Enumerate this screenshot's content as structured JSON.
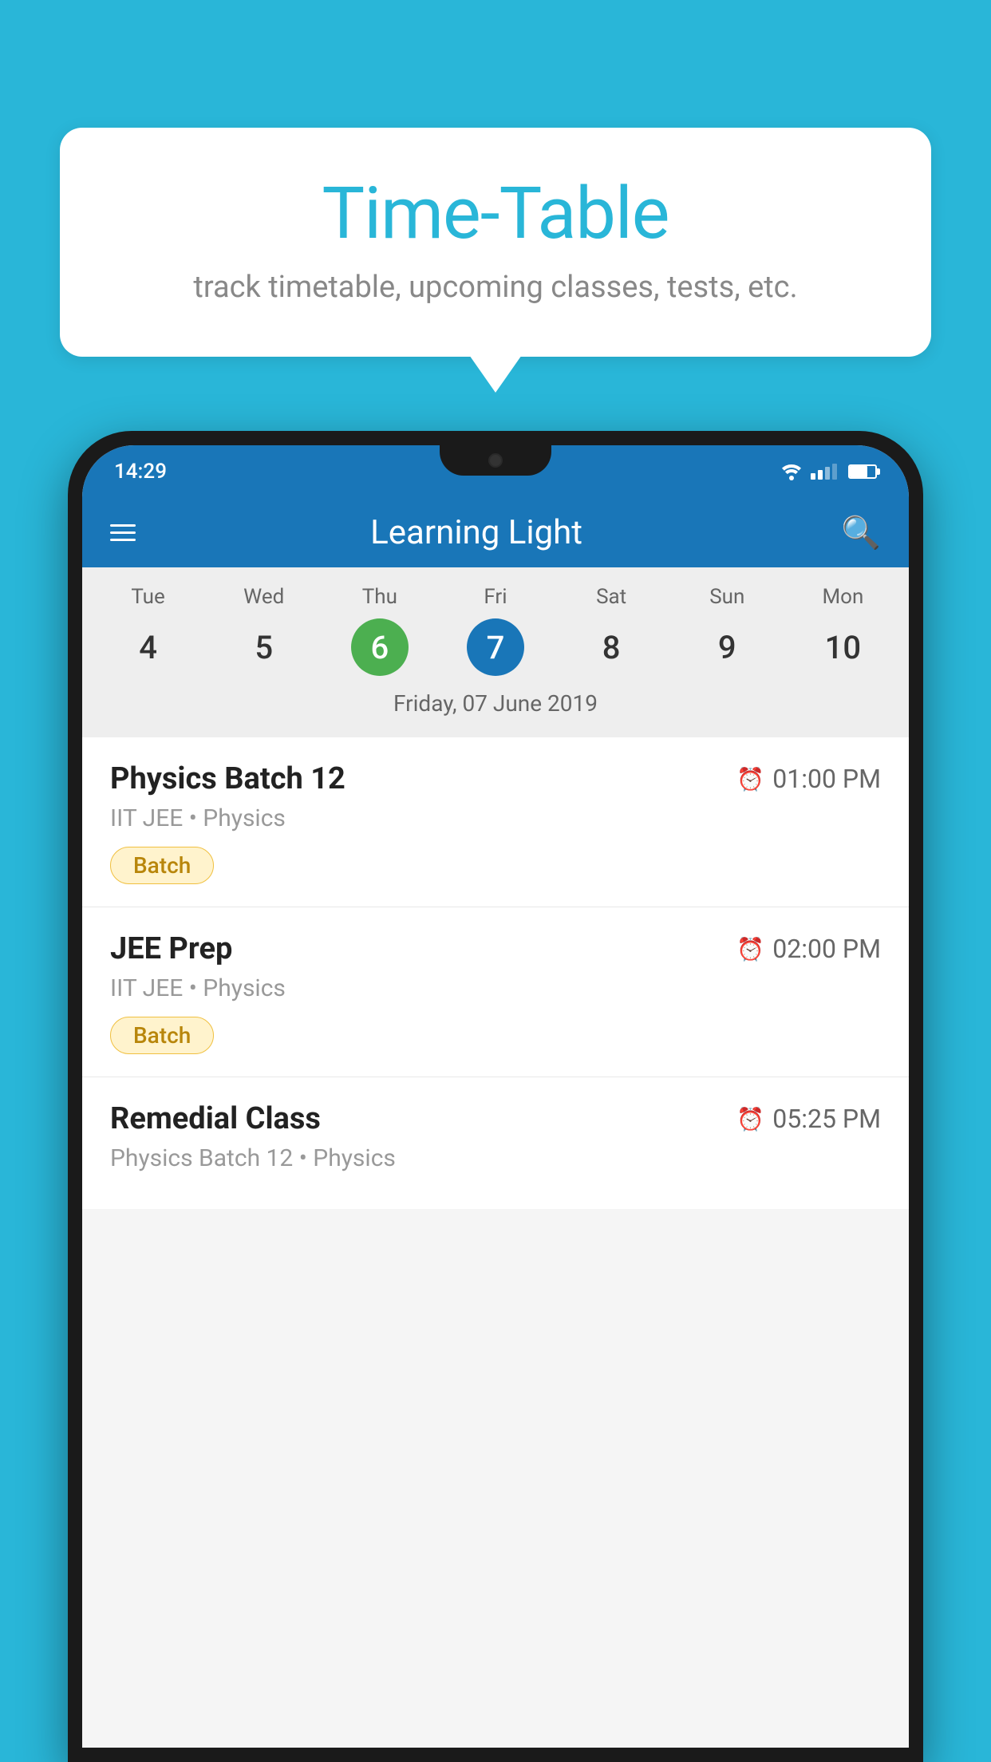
{
  "background_color": "#29B6D8",
  "speech_bubble": {
    "title": "Time-Table",
    "subtitle": "track timetable, upcoming classes, tests, etc."
  },
  "phone": {
    "status_bar": {
      "time": "14:29"
    },
    "app_header": {
      "title": "Learning Light"
    },
    "calendar": {
      "days": [
        {
          "label": "Tue",
          "number": "4"
        },
        {
          "label": "Wed",
          "number": "5"
        },
        {
          "label": "Thu",
          "number": "6",
          "state": "today"
        },
        {
          "label": "Fri",
          "number": "7",
          "state": "selected"
        },
        {
          "label": "Sat",
          "number": "8"
        },
        {
          "label": "Sun",
          "number": "9"
        },
        {
          "label": "Mon",
          "number": "10"
        }
      ],
      "selected_date": "Friday, 07 June 2019"
    },
    "schedule": [
      {
        "title": "Physics Batch 12",
        "time": "01:00 PM",
        "meta": "IIT JEE • Physics",
        "tag": "Batch"
      },
      {
        "title": "JEE Prep",
        "time": "02:00 PM",
        "meta": "IIT JEE • Physics",
        "tag": "Batch"
      },
      {
        "title": "Remedial Class",
        "time": "05:25 PM",
        "meta": "Physics Batch 12 • Physics",
        "tag": ""
      }
    ]
  }
}
